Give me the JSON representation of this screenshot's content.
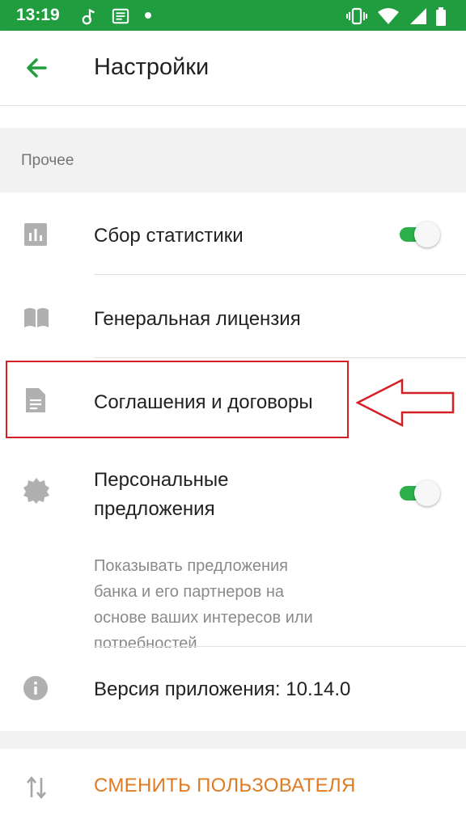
{
  "status_bar": {
    "time": "13:19",
    "icons": [
      "music-note-icon",
      "news-icon",
      "dot-icon",
      "vibrate-icon",
      "wifi-icon",
      "signal-icon",
      "battery-icon"
    ],
    "color": "#1f9d3f"
  },
  "header": {
    "back_icon": "arrow-back-icon",
    "title": "Настройки"
  },
  "section": {
    "label": "Прочее"
  },
  "items": [
    {
      "icon": "bar-chart-icon",
      "title": "Сбор статистики",
      "toggle": true
    },
    {
      "icon": "book-icon",
      "title": "Генеральная лицензия"
    },
    {
      "icon": "document-icon",
      "title": "Соглашения и договоры"
    },
    {
      "icon": "badge-icon",
      "title_line1": "Персональные",
      "title_line2": "предложения",
      "desc_lines": [
        "Показывать предложения",
        "банка и его партнеров на",
        "основе ваших интересов или",
        "потребностей"
      ],
      "toggle": true
    },
    {
      "icon": "info-icon",
      "title": "Версия приложения: 10.14.0"
    }
  ],
  "switch_user": {
    "icon": "swap-vertical-icon",
    "label": "СМЕНИТЬ ПОЛЬЗОВАТЕЛЯ"
  },
  "colors": {
    "accent": "#2bb04a",
    "orange": "#e07b22",
    "highlight": "#d32027"
  }
}
